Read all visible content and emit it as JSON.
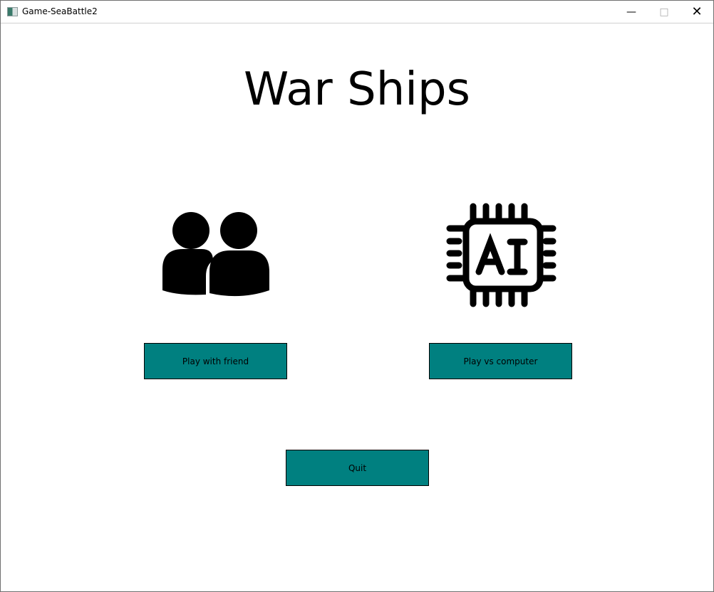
{
  "window": {
    "title": "Game-SeaBattle2",
    "minimize_icon": "minimize-icon",
    "maximize_icon": "maximize-icon",
    "close_icon": "close-icon"
  },
  "main": {
    "heading": "War Ships",
    "friend_icon": "two-users-icon",
    "ai_icon": "ai-chip-icon",
    "play_friend_label": "Play with friend",
    "play_computer_label": "Play vs computer",
    "quit_label": "Quit"
  },
  "colors": {
    "button": "#008080"
  }
}
